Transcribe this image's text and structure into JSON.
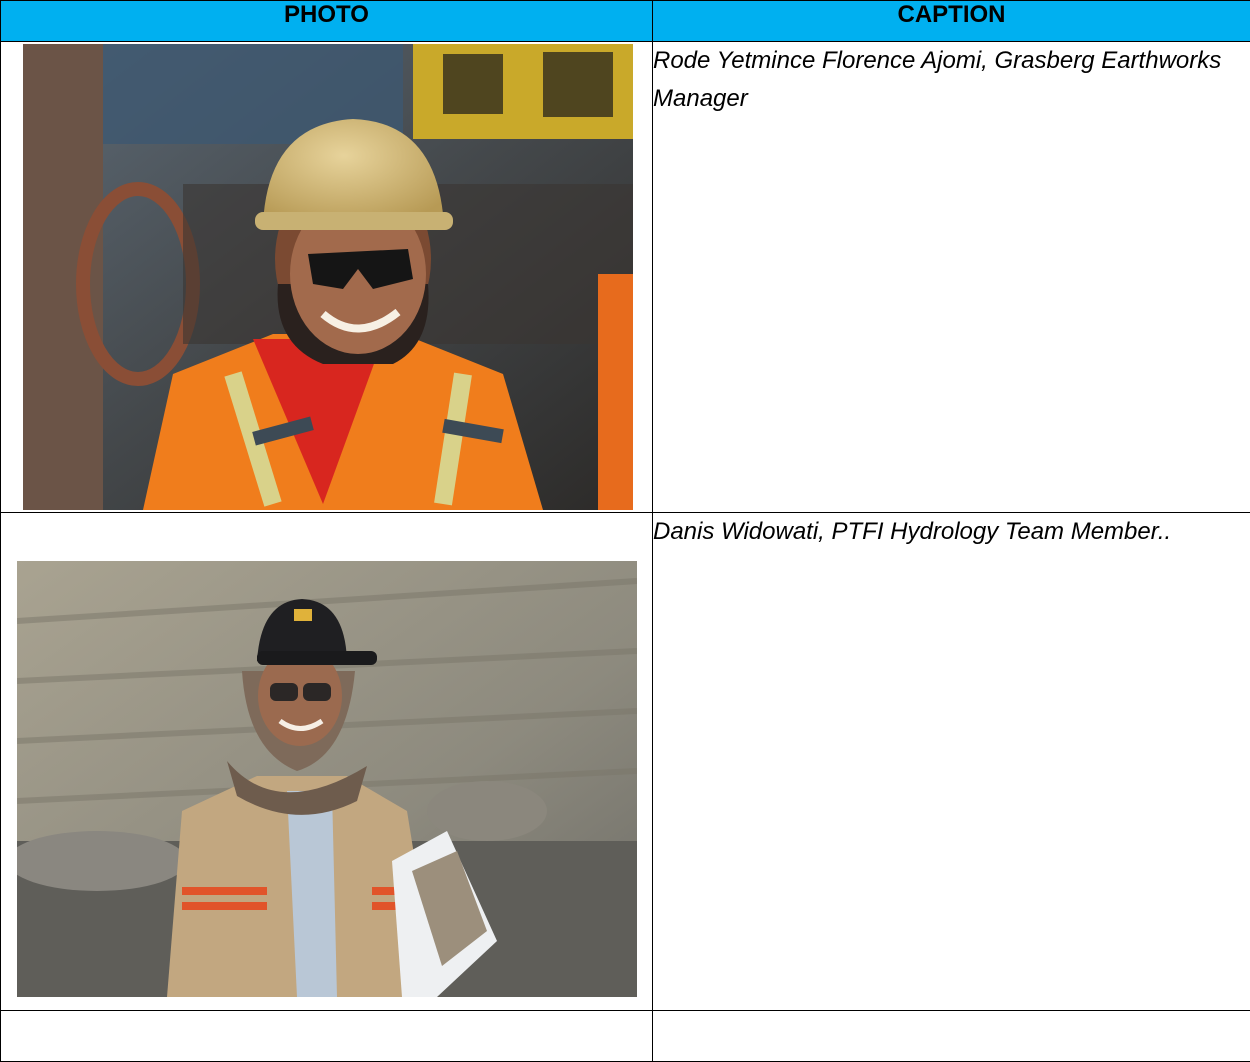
{
  "table": {
    "headers": [
      "PHOTO",
      "CAPTION"
    ],
    "rows": [
      {
        "photo_alt": "Worker in gold hard hat, sunglasses and orange high-visibility jacket",
        "caption": "Rode Yetmince Florence Ajomi,  Grasberg Earthworks Manager"
      },
      {
        "photo_alt": "Worker in black hard hat, headscarf and tan jacket holding a clipboard at a rock wall",
        "caption": "Danis Widowati, PTFI Hydrology Team Member.."
      },
      {
        "photo_alt": "",
        "caption": ""
      }
    ]
  }
}
